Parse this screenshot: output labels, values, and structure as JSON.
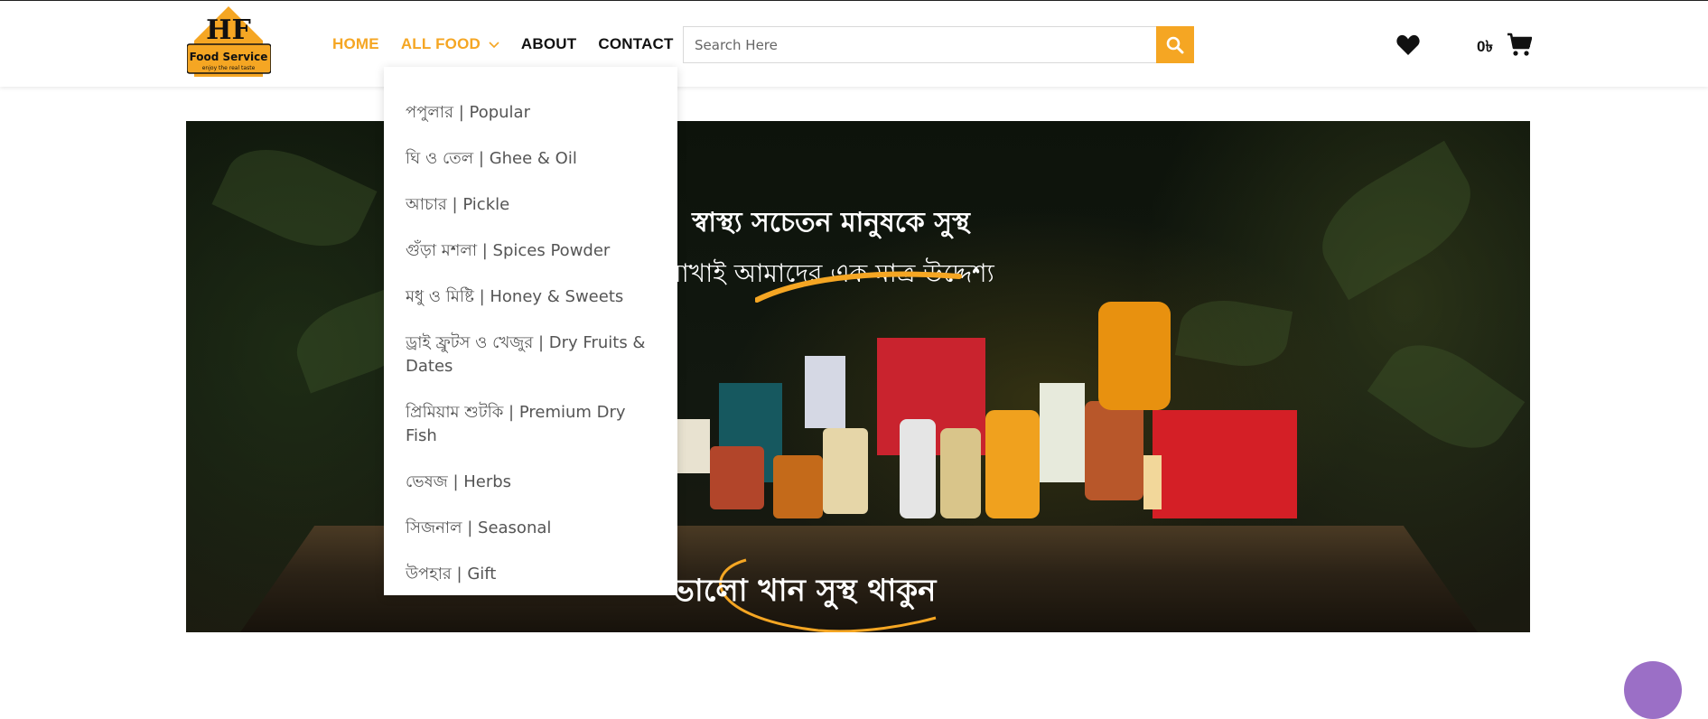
{
  "brand": {
    "logo_title": "HF",
    "logo_name": "Food Service",
    "logo_tagline": "enjoy the real taste"
  },
  "nav": {
    "home": "HOME",
    "all_food": "ALL FOOD",
    "about": "ABOUT",
    "contact": "CONTACT"
  },
  "search": {
    "placeholder": "Search Here"
  },
  "cart": {
    "total": "0৳"
  },
  "dropdown": {
    "items": [
      "পপুলার | Popular",
      "ঘি ও তেল | Ghee & Oil",
      "আচার | Pickle",
      "গুঁড়া মশলা | Spices Powder",
      "মধু ও মিষ্টি | Honey & Sweets",
      "ড্রাই ফ্রুটস ও খেজুর | Dry Fruits & Dates",
      "প্রিমিয়াম শুটকি | Premium Dry Fish",
      "ভেষজ | Herbs",
      "সিজনাল | Seasonal",
      "উপহার | Gift"
    ]
  },
  "banner": {
    "headline_1": "স্বাস্থ্য সচেতন মানুষকে সুস্থ",
    "headline_2": "রাখাই আমাদের এক মাত্র উদ্দেশ্য",
    "bottom_text": "ভালো খান সুস্থ থাকুন"
  },
  "colors": {
    "accent": "#f5a623",
    "text_dark": "#111111",
    "dropdown_text": "#555555",
    "chat": "#9b6fc6"
  }
}
